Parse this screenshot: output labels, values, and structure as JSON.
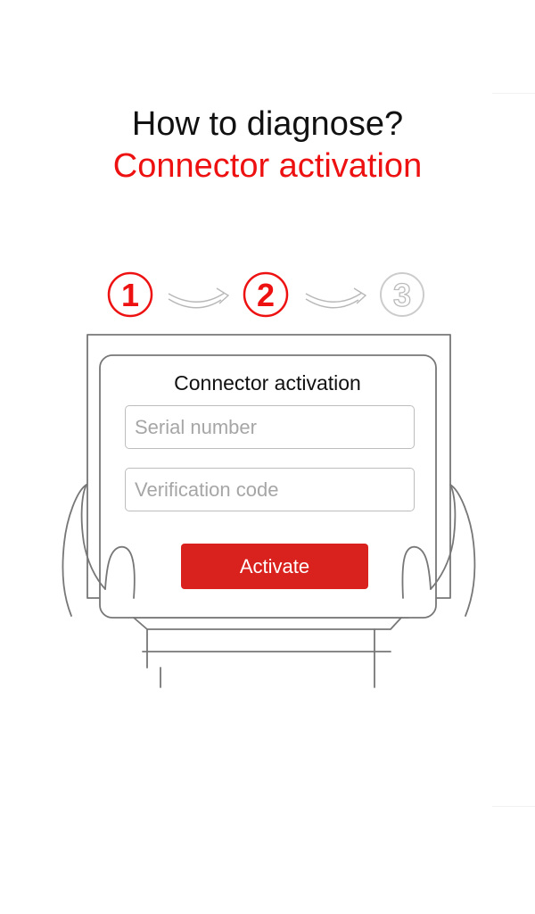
{
  "header": {
    "title": "How to diagnose?",
    "subtitle": "Connector activation"
  },
  "steps": {
    "items": [
      {
        "number": "1",
        "state": "active"
      },
      {
        "number": "2",
        "state": "active"
      },
      {
        "number": "3",
        "state": "inactive"
      }
    ],
    "active_color": "#ee1111",
    "inactive_color": "#cccccc"
  },
  "panel": {
    "title": "Connector activation",
    "serial": {
      "placeholder": "Serial number",
      "value": ""
    },
    "verification": {
      "placeholder": "Verification code",
      "value": ""
    },
    "activate_label": "Activate",
    "button_color": "#d9211e"
  }
}
